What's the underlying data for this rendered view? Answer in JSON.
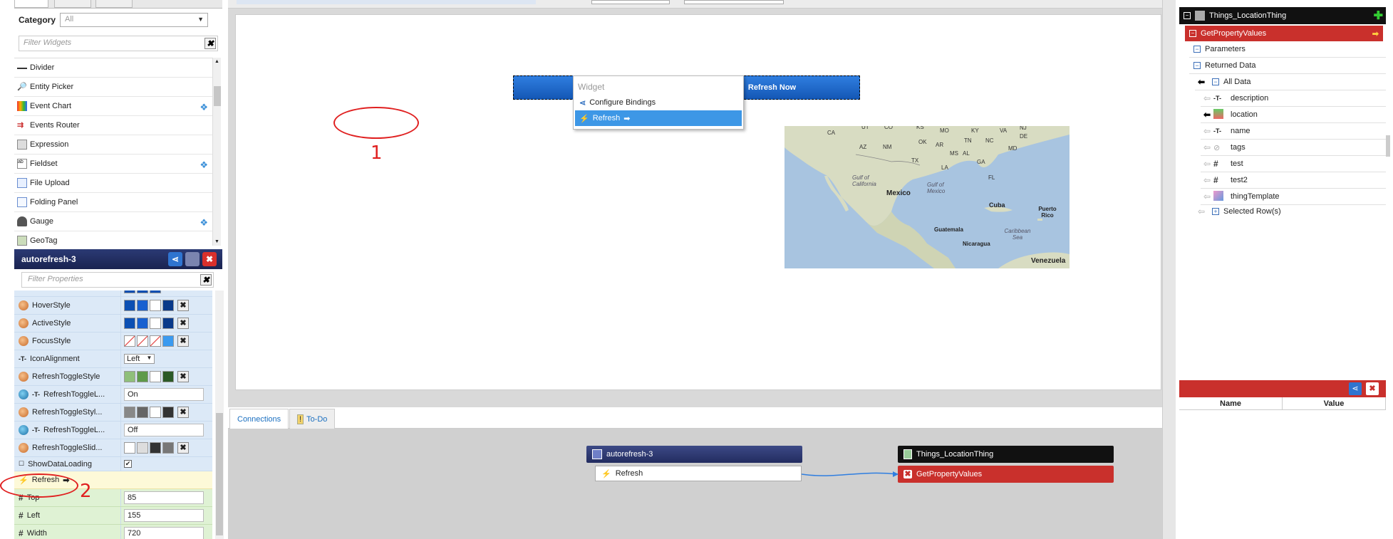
{
  "left": {
    "category_label": "Category",
    "category_value": "All",
    "filter_widgets_placeholder": "Filter Widgets",
    "widgets": [
      {
        "label": "Divider",
        "icon": "divider-icon",
        "bindable": false
      },
      {
        "label": "Entity Picker",
        "icon": "magnifier-icon",
        "bindable": false
      },
      {
        "label": "Event Chart",
        "icon": "chart-icon",
        "bindable": true
      },
      {
        "label": "Events Router",
        "icon": "router-icon",
        "bindable": false
      },
      {
        "label": "Expression",
        "icon": "expression-icon",
        "bindable": false
      },
      {
        "label": "Fieldset",
        "icon": "fieldset-icon",
        "bindable": true
      },
      {
        "label": "File Upload",
        "icon": "upload-icon",
        "bindable": false
      },
      {
        "label": "Folding Panel",
        "icon": "panel-icon",
        "bindable": false
      },
      {
        "label": "Gauge",
        "icon": "gauge-icon",
        "bindable": true
      },
      {
        "label": "GeoTag",
        "icon": "geotag-icon",
        "bindable": false
      }
    ],
    "props_title": "autorefresh-3",
    "filter_props_placeholder": "Filter Properties",
    "props": {
      "hover": "HoverStyle",
      "active": "ActiveStyle",
      "focus": "FocusStyle",
      "icon_align": "IconAlignment",
      "icon_align_value": "Left",
      "rts": "RefreshToggleStyle",
      "rtl1": "RefreshToggleL...",
      "rtl1_value": "On",
      "rtsty": "RefreshToggleStyl...",
      "rtl2": "RefreshToggleL...",
      "rtl2_value": "Off",
      "rtslid": "RefreshToggleSlid...",
      "sdl": "ShowDataLoading",
      "refresh": "Refresh",
      "top": "Top",
      "top_value": "85",
      "left": "Left",
      "left_value": "155",
      "width": "Width",
      "width_value": "720"
    }
  },
  "canvas": {
    "button_label": "Refresh Now",
    "menu_title": "Widget",
    "menu_configure": "Configure Bindings",
    "menu_refresh": "Refresh",
    "annotation_1": "1",
    "annotation_2": "2",
    "map_labels": {
      "mexico": "Mexico",
      "gulf": "Gulf of California",
      "gulf_mex": "Gulf of Mexico",
      "cuba": "Cuba",
      "puerto": "Puerto Rico",
      "guatemala": "Guatemala",
      "nicaragua": "Nicaragua",
      "caribbean": "Caribbean Sea",
      "venezuela": "Venezuela",
      "states": [
        "CA",
        "UT",
        "CO",
        "KS",
        "MO",
        "KY",
        "VA",
        "NJ",
        "AZ",
        "NM",
        "OK",
        "AR",
        "TN",
        "NC",
        "DE",
        "MD",
        "TX",
        "MS",
        "AL",
        "GA",
        "LA",
        "FL"
      ]
    }
  },
  "bottom": {
    "tab_connections": "Connections",
    "tab_todo": "To-Do",
    "node_source": "autorefresh-3",
    "node_source_event": "Refresh",
    "node_target": "Things_LocationThing",
    "node_target_service": "GetPropertyValues"
  },
  "right": {
    "thing": "Things_LocationThing",
    "service": "GetPropertyValues",
    "parameters": "Parameters",
    "returned": "Returned Data",
    "all_data": "All Data",
    "fields": [
      "description",
      "location",
      "name",
      "tags",
      "test",
      "test2",
      "thingTemplate"
    ],
    "selected_rows": "Selected Row(s)",
    "col_name": "Name",
    "col_value": "Value"
  },
  "colors": {
    "accent_blue": "#1f6fd6",
    "service_red": "#c9302c",
    "header_navy": "#1a2350"
  }
}
